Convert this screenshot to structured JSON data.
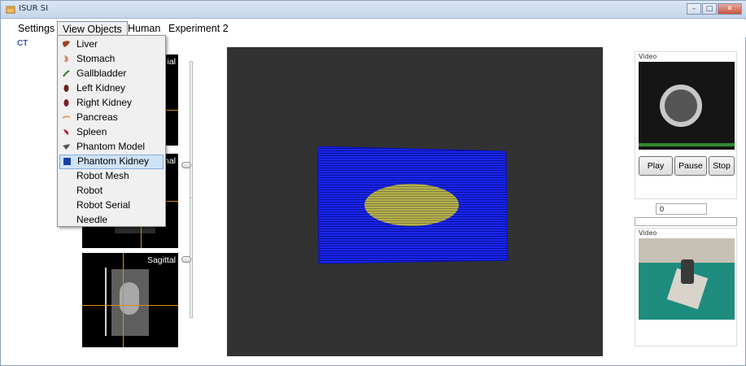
{
  "window": {
    "title": "ISUR SI",
    "controls": [
      "–",
      "□",
      "✕"
    ]
  },
  "menubar": {
    "items": [
      "Settings",
      "View Objects",
      "Human",
      "Experiment 2"
    ],
    "open_item": "View Objects"
  },
  "subtab": {
    "label": "CT"
  },
  "view_objects_menu": [
    {
      "label": "Liver",
      "icon": "liver-icon",
      "color": "#a0401e"
    },
    {
      "label": "Stomach",
      "icon": "stomach-icon",
      "color": "#d88a6a"
    },
    {
      "label": "Gallbladder",
      "icon": "gallbladder-icon",
      "color": "#2f7a2a"
    },
    {
      "label": "Left Kidney",
      "icon": "left-kidney-icon",
      "color": "#6a1f1f"
    },
    {
      "label": "Right Kidney",
      "icon": "right-kidney-icon",
      "color": "#7a1f2a"
    },
    {
      "label": "Pancreas",
      "icon": "pancreas-icon",
      "color": "#e0a070"
    },
    {
      "label": "Spleen",
      "icon": "spleen-icon",
      "color": "#b0203a"
    },
    {
      "label": "Phantom Model",
      "icon": "phantom-model-icon",
      "color": "#555555"
    },
    {
      "label": "Phantom Kidney",
      "icon": "phantom-kidney-icon",
      "color": "#1a3fa0",
      "hovered": true
    },
    {
      "label": "Robot Mesh",
      "icon": null
    },
    {
      "label": "Robot",
      "icon": null
    },
    {
      "label": "Robot Serial",
      "icon": null
    },
    {
      "label": "Needle",
      "icon": null
    }
  ],
  "slices": {
    "axial": {
      "label_visible": "ial"
    },
    "coronal": {
      "label_visible": "nal"
    },
    "sagittal": {
      "label": "Sagittal"
    }
  },
  "video_top": {
    "label": "Video",
    "buttons": {
      "play": "Play",
      "pause": "Pause",
      "stop": "Stop"
    }
  },
  "frame_field": {
    "value": "0"
  },
  "video_bottom": {
    "label": "Video"
  },
  "colors": {
    "mesh_blue": "#0a14e0",
    "kidney_yellow": "#d8d23a",
    "crosshair": "#e08a1a",
    "viewport_bg": "#323232"
  }
}
